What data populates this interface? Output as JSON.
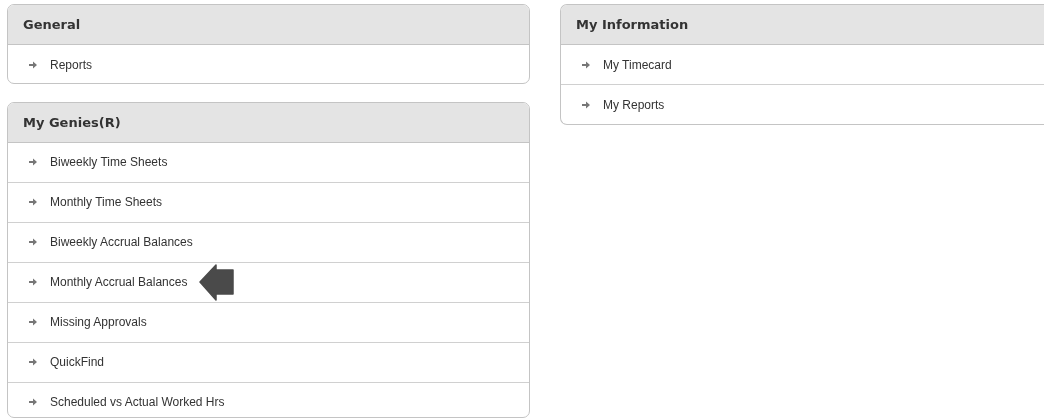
{
  "left_column": [
    {
      "title": "General",
      "items": [
        {
          "label": "Reports",
          "pointed": false
        }
      ]
    },
    {
      "title": "My Genies(R)",
      "items": [
        {
          "label": "Biweekly Time Sheets",
          "pointed": false
        },
        {
          "label": "Monthly Time Sheets",
          "pointed": false
        },
        {
          "label": "Biweekly Accrual Balances",
          "pointed": false
        },
        {
          "label": "Monthly Accrual Balances",
          "pointed": true
        },
        {
          "label": "Missing Approvals",
          "pointed": false
        },
        {
          "label": "QuickFind",
          "pointed": false
        },
        {
          "label": "Scheduled vs Actual Worked Hrs",
          "pointed": false
        }
      ]
    }
  ],
  "right_column": [
    {
      "title": "My Information",
      "items": [
        {
          "label": "My Timecard",
          "pointed": false
        },
        {
          "label": "My Reports",
          "pointed": false
        }
      ]
    }
  ]
}
